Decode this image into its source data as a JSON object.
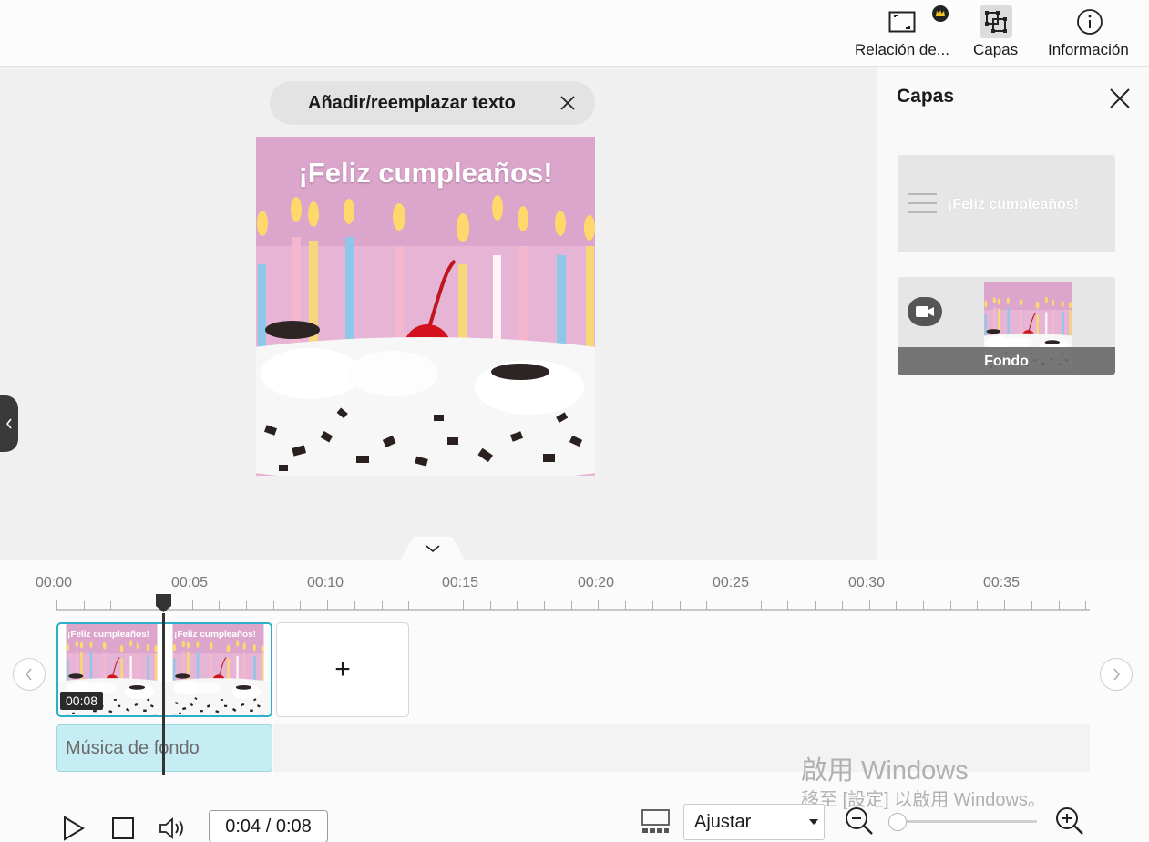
{
  "toolbar": {
    "aspect_label": "Relación de...",
    "layers_label": "Capas",
    "info_label": "Información"
  },
  "preview": {
    "text_pill_label": "Añadir/reemplazar texto",
    "canvas_text": "¡Feliz cumpleaños!"
  },
  "layers_panel": {
    "title": "Capas",
    "text_layer_label": "¡Feliz cumpleaños!",
    "bg_layer_label": "Fondo"
  },
  "timeline": {
    "ticks": [
      "00:00",
      "00:05",
      "00:10",
      "00:15",
      "00:20",
      "00:25",
      "00:30",
      "00:35"
    ],
    "clip_title": "¡Feliz cumpleaños!",
    "clip_duration": "00:08",
    "add_label": "+",
    "music_label": "Música de fondo",
    "time_display": "0:04 / 0:08",
    "fit_option": "Ajustar"
  },
  "watermark": {
    "line1": "啟用 Windows",
    "line2": "移至 [設定] 以啟用 Windows。"
  }
}
